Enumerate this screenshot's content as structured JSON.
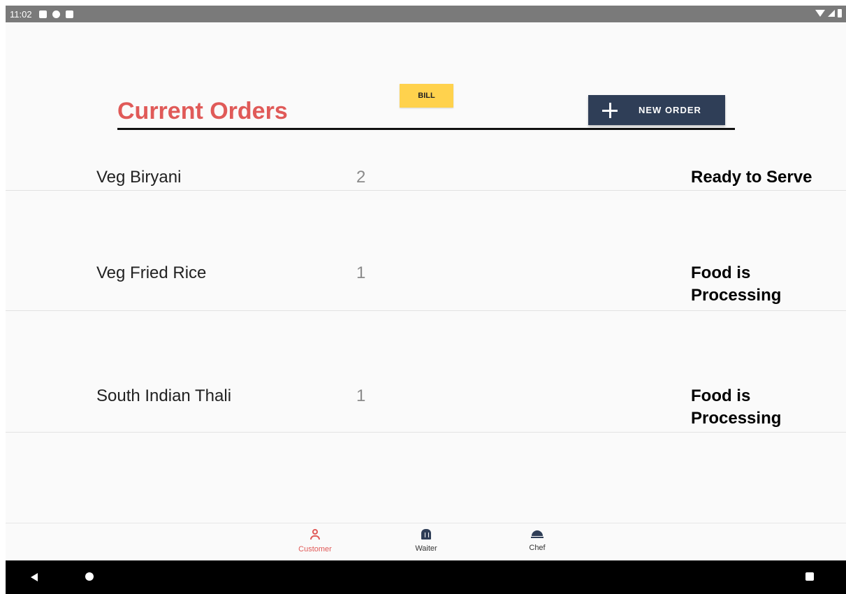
{
  "status_bar": {
    "time": "11:02",
    "left_icons": [
      "notification-a-icon",
      "sync-icon",
      "sd-card-icon"
    ],
    "right_icons": [
      "wifi-icon",
      "signal-icon",
      "battery-icon"
    ]
  },
  "header": {
    "title": "Current Orders",
    "bill_label": "BILL",
    "new_order_label": "NEW ORDER"
  },
  "orders": [
    {
      "name": "Veg Biryani",
      "quantity": "2",
      "status": "Ready to Serve"
    },
    {
      "name": "Veg Fried Rice",
      "quantity": "1",
      "status": "Food is Processing"
    },
    {
      "name": "South Indian Thali",
      "quantity": "1",
      "status": "Food is Processing"
    }
  ],
  "bottom_nav": {
    "items": [
      {
        "label": "Customer",
        "icon": "user-icon",
        "active": true
      },
      {
        "label": "Waiter",
        "icon": "waiter-icon",
        "active": false
      },
      {
        "label": "Chef",
        "icon": "cloche-icon",
        "active": false
      }
    ]
  },
  "colors": {
    "accent": "#e05a58",
    "bill_button": "#ffd24d",
    "new_order_button": "#2f3e57",
    "status_bar": "#7a7a7a"
  }
}
